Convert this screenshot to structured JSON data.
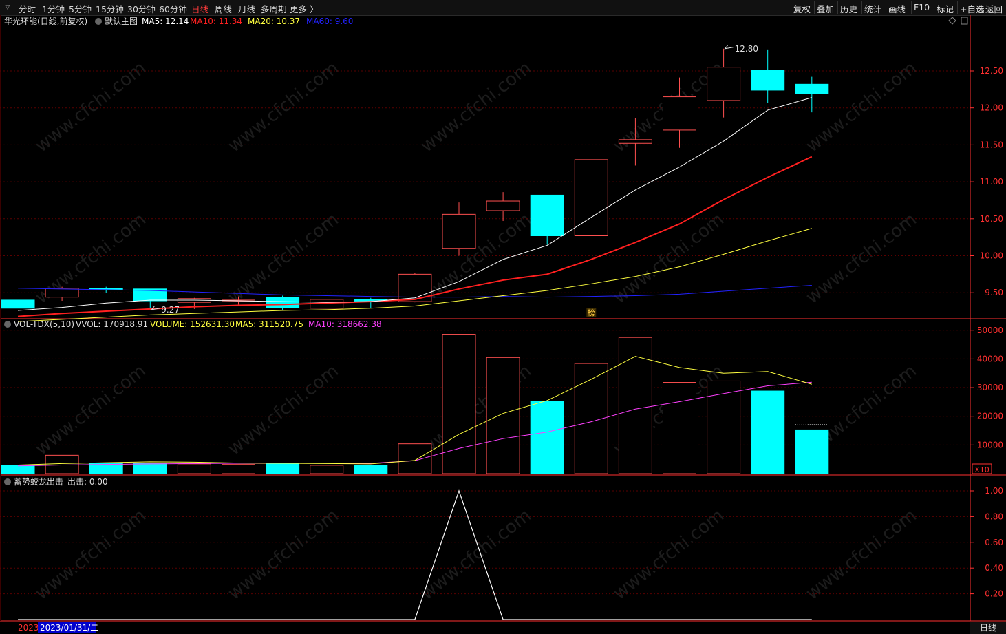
{
  "toolbar": {
    "periods": [
      "分时",
      "1分钟",
      "5分钟",
      "15分钟",
      "30分钟",
      "60分钟",
      "日线",
      "周线",
      "月线",
      "多周期",
      "更多 〉"
    ],
    "active_period": "日线",
    "right_buttons": [
      "复权",
      "叠加",
      "历史",
      "统计",
      "画线",
      "F10",
      "标记",
      "+自选",
      "返回"
    ]
  },
  "colors": {
    "up": "#ff5050",
    "down": "#00ffff",
    "ma5": "#ffffff",
    "ma10": "#ff2020",
    "ma20": "#ffff40",
    "ma60": "#2222ff",
    "volma10": "#ff40ff",
    "grid": "#5a0000",
    "axis": "#ff3030"
  },
  "chart_data": [
    {
      "type": "candlestick",
      "title": "华光环能(日线,前复权)",
      "indicator": "默认主图",
      "legend": [
        {
          "label": "MA5: 12.14",
          "color": "#ffffff"
        },
        {
          "label": "MA10: 11.34",
          "color": "#ff2020"
        },
        {
          "label": "MA20: 10.37",
          "color": "#ffff40"
        },
        {
          "label": "MA60: 9.60",
          "color": "#2222ff"
        }
      ],
      "ylim": [
        9.0,
        12.9
      ],
      "yticks": [
        9.5,
        10.0,
        10.5,
        11.0,
        11.5,
        12.0,
        12.5
      ],
      "ytick_labels": [
        "9.50",
        "10.00",
        "10.50",
        "11.00",
        "11.50",
        "12.00",
        "12.50"
      ],
      "annotations": [
        {
          "text": "12.80",
          "price": 12.8,
          "bar": 16
        },
        {
          "text": "9.27",
          "price": 9.27,
          "bar": 3
        }
      ],
      "marker_text": "榜",
      "marker_bar": 13,
      "candles": [
        {
          "o": 9.4,
          "h": 9.4,
          "l": 9.29,
          "c": 9.29
        },
        {
          "o": 9.44,
          "h": 9.58,
          "l": 9.39,
          "c": 9.56
        },
        {
          "o": 9.56,
          "h": 9.58,
          "l": 9.5,
          "c": 9.54
        },
        {
          "o": 9.55,
          "h": 9.55,
          "l": 9.27,
          "c": 9.39
        },
        {
          "o": 9.37,
          "h": 9.43,
          "l": 9.28,
          "c": 9.42
        },
        {
          "o": 9.38,
          "h": 9.45,
          "l": 9.34,
          "c": 9.4
        },
        {
          "o": 9.44,
          "h": 9.46,
          "l": 9.26,
          "c": 9.3
        },
        {
          "o": 9.29,
          "h": 9.41,
          "l": 9.29,
          "c": 9.41
        },
        {
          "o": 9.41,
          "h": 9.43,
          "l": 9.29,
          "c": 9.38
        },
        {
          "o": 9.38,
          "h": 9.77,
          "l": 9.37,
          "c": 9.75
        },
        {
          "o": 10.1,
          "h": 10.72,
          "l": 10.0,
          "c": 10.56
        },
        {
          "o": 10.61,
          "h": 10.86,
          "l": 10.47,
          "c": 10.74
        },
        {
          "o": 10.82,
          "h": 10.82,
          "l": 10.15,
          "c": 10.27
        },
        {
          "o": 10.27,
          "h": 11.3,
          "l": 10.27,
          "c": 11.3
        },
        {
          "o": 11.52,
          "h": 11.86,
          "l": 11.22,
          "c": 11.57
        },
        {
          "o": 11.7,
          "h": 12.41,
          "l": 11.46,
          "c": 12.15
        },
        {
          "o": 12.1,
          "h": 12.8,
          "l": 11.87,
          "c": 12.55
        },
        {
          "o": 12.51,
          "h": 12.79,
          "l": 12.07,
          "c": 12.24
        },
        {
          "o": 12.32,
          "h": 12.42,
          "l": 11.94,
          "c": 12.19
        }
      ],
      "ma5": [
        9.26,
        9.3,
        9.36,
        9.4,
        9.4,
        9.39,
        9.38,
        9.37,
        9.38,
        9.43,
        9.65,
        9.95,
        10.14,
        10.52,
        10.89,
        11.2,
        11.55,
        11.97,
        12.14
      ],
      "ma10": [
        9.18,
        9.22,
        9.25,
        9.28,
        9.31,
        9.33,
        9.34,
        9.36,
        9.38,
        9.41,
        9.55,
        9.67,
        9.75,
        9.95,
        10.18,
        10.43,
        10.76,
        11.06,
        11.34
      ],
      "ma20": [
        9.11,
        9.14,
        9.17,
        9.2,
        9.22,
        9.24,
        9.26,
        9.27,
        9.29,
        9.32,
        9.39,
        9.46,
        9.53,
        9.62,
        9.72,
        9.85,
        10.02,
        10.2,
        10.37
      ],
      "ma60": [
        9.56,
        9.55,
        9.54,
        9.53,
        9.51,
        9.49,
        9.47,
        9.46,
        9.45,
        9.44,
        9.44,
        9.45,
        9.44,
        9.45,
        9.46,
        9.48,
        9.52,
        9.56,
        9.6
      ]
    },
    {
      "type": "bar",
      "title": "VOL-TDX(5,10)",
      "legend": [
        {
          "label": "VVOL: 170918.91",
          "color": "#dddddd"
        },
        {
          "label": "VOLUME: 152631.30",
          "color": "#ffff40"
        },
        {
          "label": "MA5: 311520.75",
          "color": "#ffff40"
        },
        {
          "label": "MA10: 318662.38",
          "color": "#ff40ff"
        }
      ],
      "ylim": [
        0,
        51000
      ],
      "yticks": [
        10000,
        20000,
        30000,
        40000,
        50000
      ],
      "ytick_labels": [
        "10000",
        "20000",
        "30000",
        "40000",
        "50000"
      ],
      "unit_label": "X10",
      "volumes": [
        2800,
        6400,
        3700,
        3700,
        3400,
        3200,
        3700,
        2900,
        3000,
        10400,
        48600,
        40500,
        25300,
        38400,
        47500,
        31800,
        32300,
        28800,
        15263
      ],
      "ma5": [
        3000,
        3500,
        3800,
        4100,
        4000,
        3700,
        3600,
        3500,
        3400,
        4600,
        13700,
        21000,
        25500,
        32900,
        40900,
        37000,
        35000,
        35600,
        31152
      ],
      "ma10": [
        2700,
        3000,
        3200,
        3400,
        3500,
        3600,
        3600,
        3600,
        3600,
        4500,
        8800,
        12200,
        14500,
        18100,
        22500,
        25100,
        27900,
        30600,
        31866
      ],
      "dotted_last": 17091
    },
    {
      "type": "line",
      "title": "蓄势蛟龙出击",
      "legend": [
        {
          "label": "出击: 0.00",
          "color": "#dddddd"
        }
      ],
      "ylim": [
        0,
        1.05
      ],
      "yticks": [
        0.2,
        0.4,
        0.6,
        0.8,
        1.0
      ],
      "ytick_labels": [
        "0.20",
        "0.40",
        "0.60",
        "0.80",
        "1.00"
      ],
      "values": [
        0,
        0,
        0,
        0,
        0,
        0,
        0,
        0,
        0,
        0,
        1,
        0,
        0,
        0,
        0,
        0,
        0,
        0,
        0
      ]
    }
  ],
  "date_axis": {
    "year": "2023",
    "date": "2023/01/31/二"
  },
  "bottom_tab": "日线"
}
